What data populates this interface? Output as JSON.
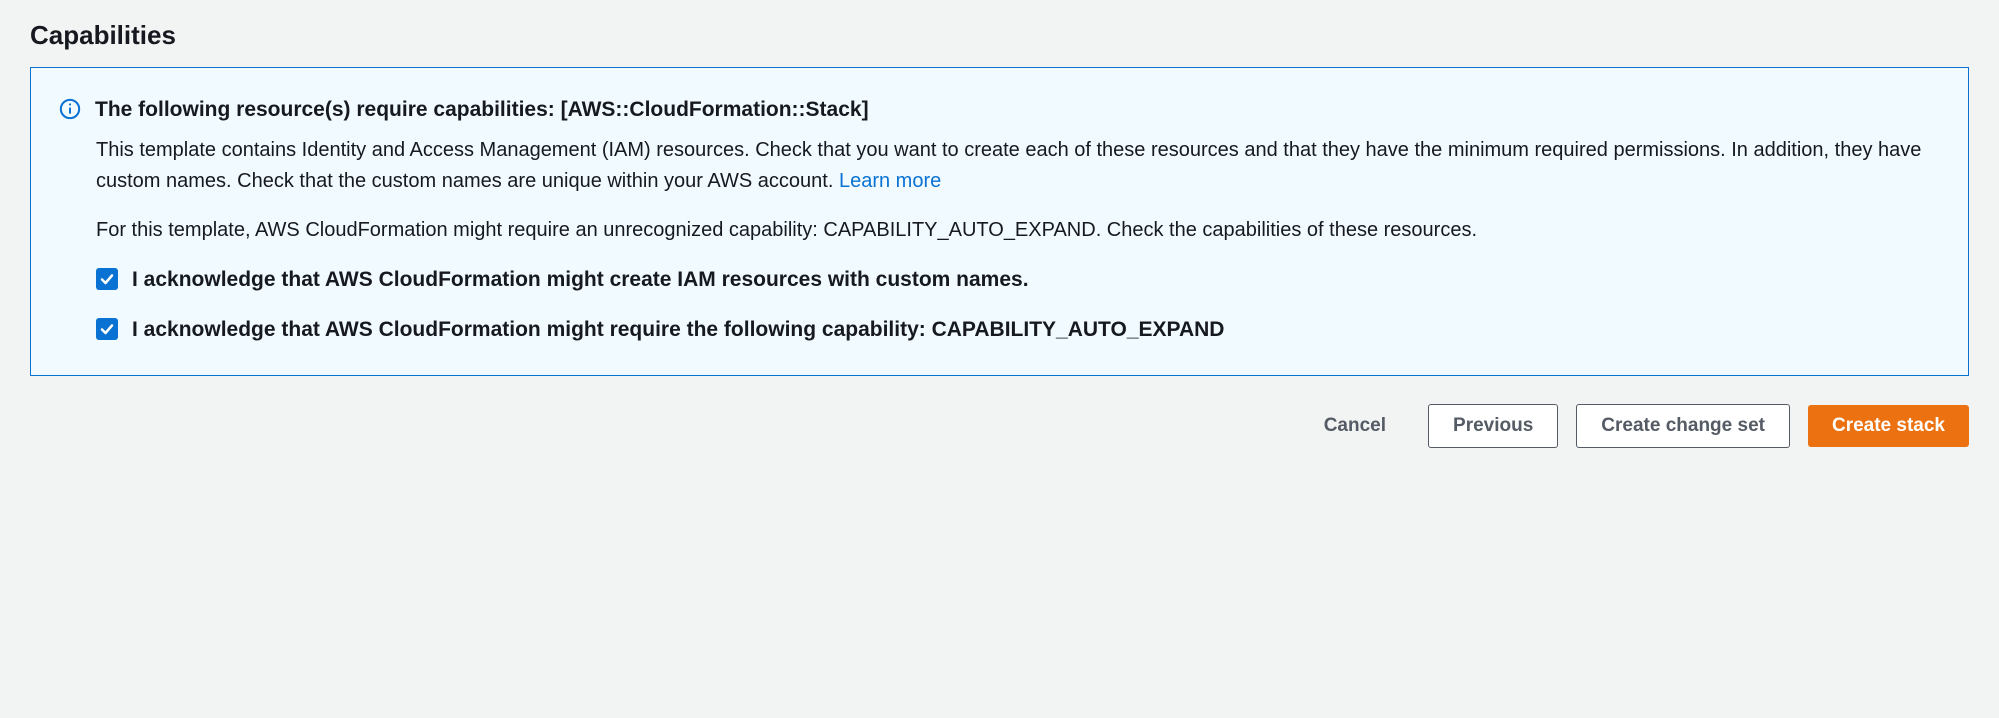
{
  "section": {
    "title": "Capabilities"
  },
  "alert": {
    "title": "The following resource(s) require capabilities: [AWS::CloudFormation::Stack]",
    "para1_before": "This template contains Identity and Access Management (IAM) resources. Check that you want to create each of these resources and that they have the minimum required permissions. In addition, they have custom names. Check that the custom names are unique within your AWS account.  ",
    "learn_more": "Learn more",
    "para2": "For this template, AWS CloudFormation might require an unrecognized capability: CAPABILITY_AUTO_EXPAND. Check the capabilities of these resources."
  },
  "checkboxes": {
    "item1": {
      "label": "I acknowledge that AWS CloudFormation might create IAM resources with custom names."
    },
    "item2": {
      "label": "I acknowledge that AWS CloudFormation might require the following capability: CAPABILITY_AUTO_EXPAND"
    }
  },
  "buttons": {
    "cancel": "Cancel",
    "previous": "Previous",
    "create_change_set": "Create change set",
    "create_stack": "Create stack"
  }
}
